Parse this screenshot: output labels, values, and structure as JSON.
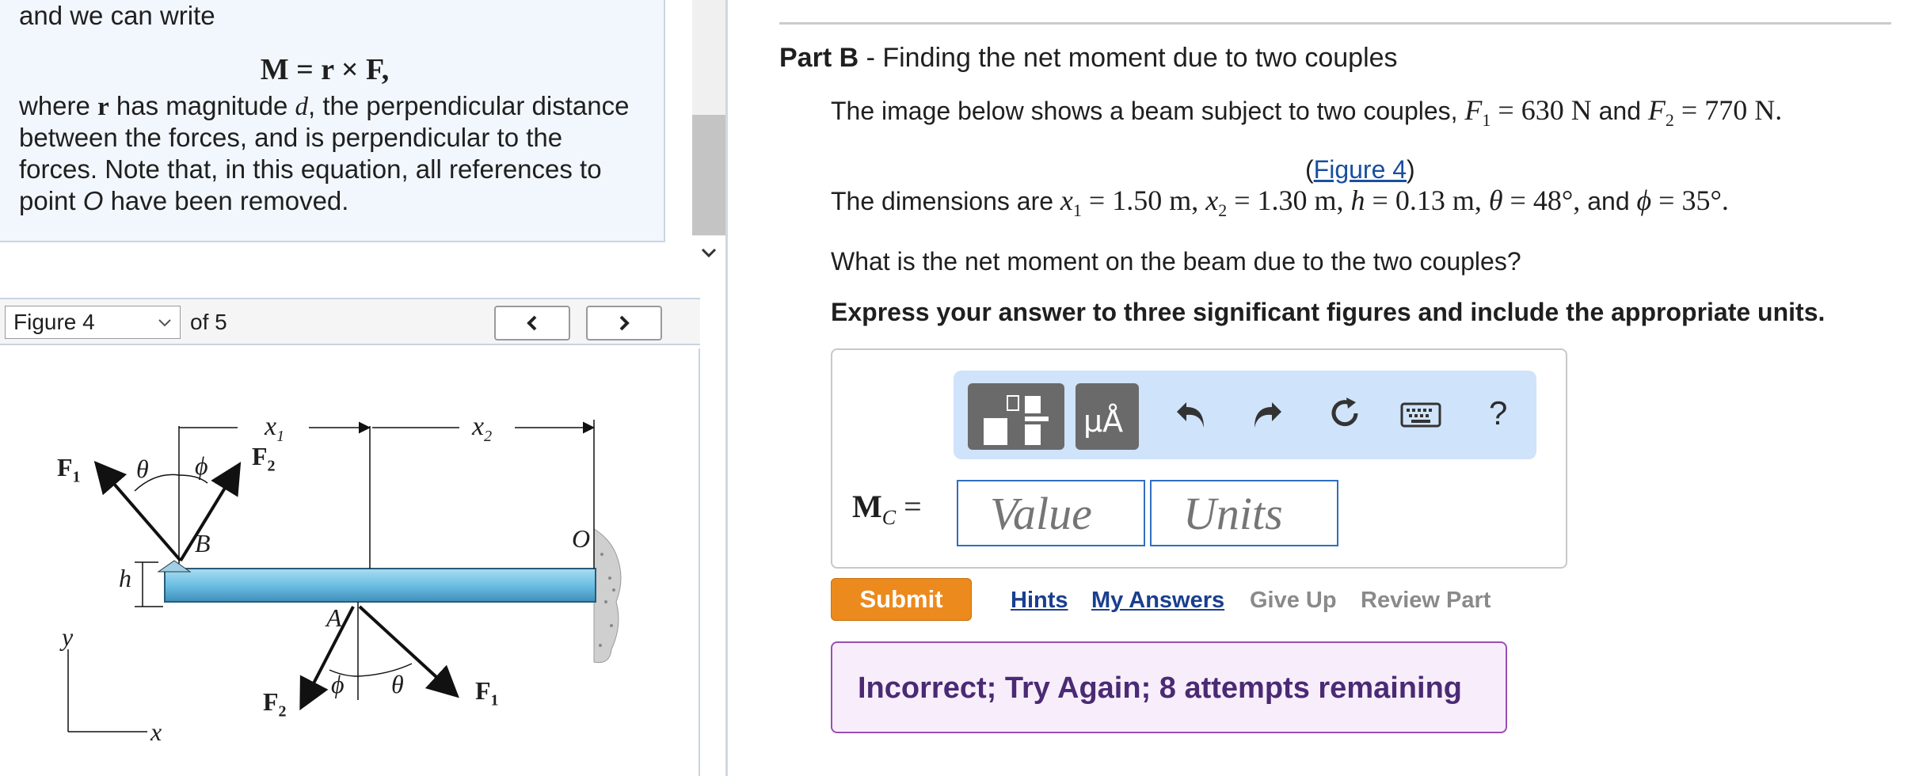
{
  "left_panel": {
    "line1": "and we can write",
    "equation": "M = r × F,",
    "para_line1_a": "where ",
    "para_line1_r": "r",
    "para_line1_b": " has magnitude ",
    "para_line1_d": "d",
    "para_line1_c": ", the perpendicular distance",
    "para_line2": "between the forces, and is perpendicular to the",
    "para_line3": "forces. Note that, in this equation, all references to",
    "para_line4_a": "point ",
    "para_line4_o": "O",
    "para_line4_b": " have been removed."
  },
  "figure_nav": {
    "selected": "Figure 4",
    "of_label": "of 5",
    "prev_icon": "chevron-left-icon",
    "next_icon": "chevron-right-icon"
  },
  "figure": {
    "label_x1": "x",
    "label_x1_sub": "1",
    "label_x2": "x",
    "label_x2_sub": "2",
    "label_F1_top": "F",
    "label_F1_top_sub": "1",
    "label_F2_top": "F",
    "label_F2_top_sub": "2",
    "label_theta_top": "θ",
    "label_phi_top": "ϕ",
    "label_B": "B",
    "label_O": "O",
    "label_h": "h",
    "label_A": "A",
    "label_phi_bot": "ϕ",
    "label_theta_bot": "θ",
    "label_F2_bot": "F",
    "label_F2_bot_sub": "2",
    "label_F1_bot": "F",
    "label_F1_bot_sub": "1",
    "label_y": "y",
    "label_x": "x"
  },
  "part": {
    "prefix": "Part B",
    "dash": " - ",
    "title": "Finding the net moment due to two couples"
  },
  "problem": {
    "line1_a": "The image below shows a beam subject to two couples, ",
    "line1_F1": "F",
    "line1_F1_sub": "1",
    "line1_F1_val": " = 630 N",
    "line1_and": " and ",
    "line1_F2": "F",
    "line1_F2_sub": "2",
    "line1_F2_val": " = 770 N.",
    "figure_link_open": "(",
    "figure_link": "Figure 4",
    "figure_link_close": ")",
    "dims_a": "The dimensions are ",
    "dims_x1": "x",
    "dims_x1_sub": "1",
    "dims_x1_val": " = 1.50 m, ",
    "dims_x2": "x",
    "dims_x2_sub": "2",
    "dims_x2_val": " = 1.30 m, ",
    "dims_h": "h",
    "dims_h_val": " = 0.13 m, ",
    "dims_theta": "θ",
    "dims_theta_val": " = 48°, ",
    "dims_and": "and ",
    "dims_phi": "ϕ",
    "dims_phi_val": " = 35°.",
    "question": "What is the net moment on the beam due to the two couples?",
    "instruction": "Express your answer to three significant figures and include the appropriate units."
  },
  "toolbar": {
    "templates_icon": "templates-icon",
    "units_label": "μÅ",
    "undo_icon": "undo-icon",
    "redo_icon": "redo-icon",
    "reset_icon": "reset-icon",
    "keyboard_icon": "keyboard-icon",
    "help_label": "?"
  },
  "answer": {
    "label_M": "M",
    "label_sub": "C",
    "label_eq": " =",
    "value_placeholder": "Value",
    "units_placeholder": "Units"
  },
  "actions": {
    "submit": "Submit",
    "hints": "Hints",
    "my_answers": "My Answers",
    "give_up": "Give Up",
    "review_part": "Review Part"
  },
  "feedback": {
    "text": "Incorrect; Try Again; 8 attempts remaining"
  },
  "colors": {
    "submit_bg": "#ec8a1d",
    "feedback_border": "#9a4fb4",
    "feedback_text": "#4a2a74",
    "link": "#1a3f8f",
    "beam": "#7ec6e6"
  }
}
